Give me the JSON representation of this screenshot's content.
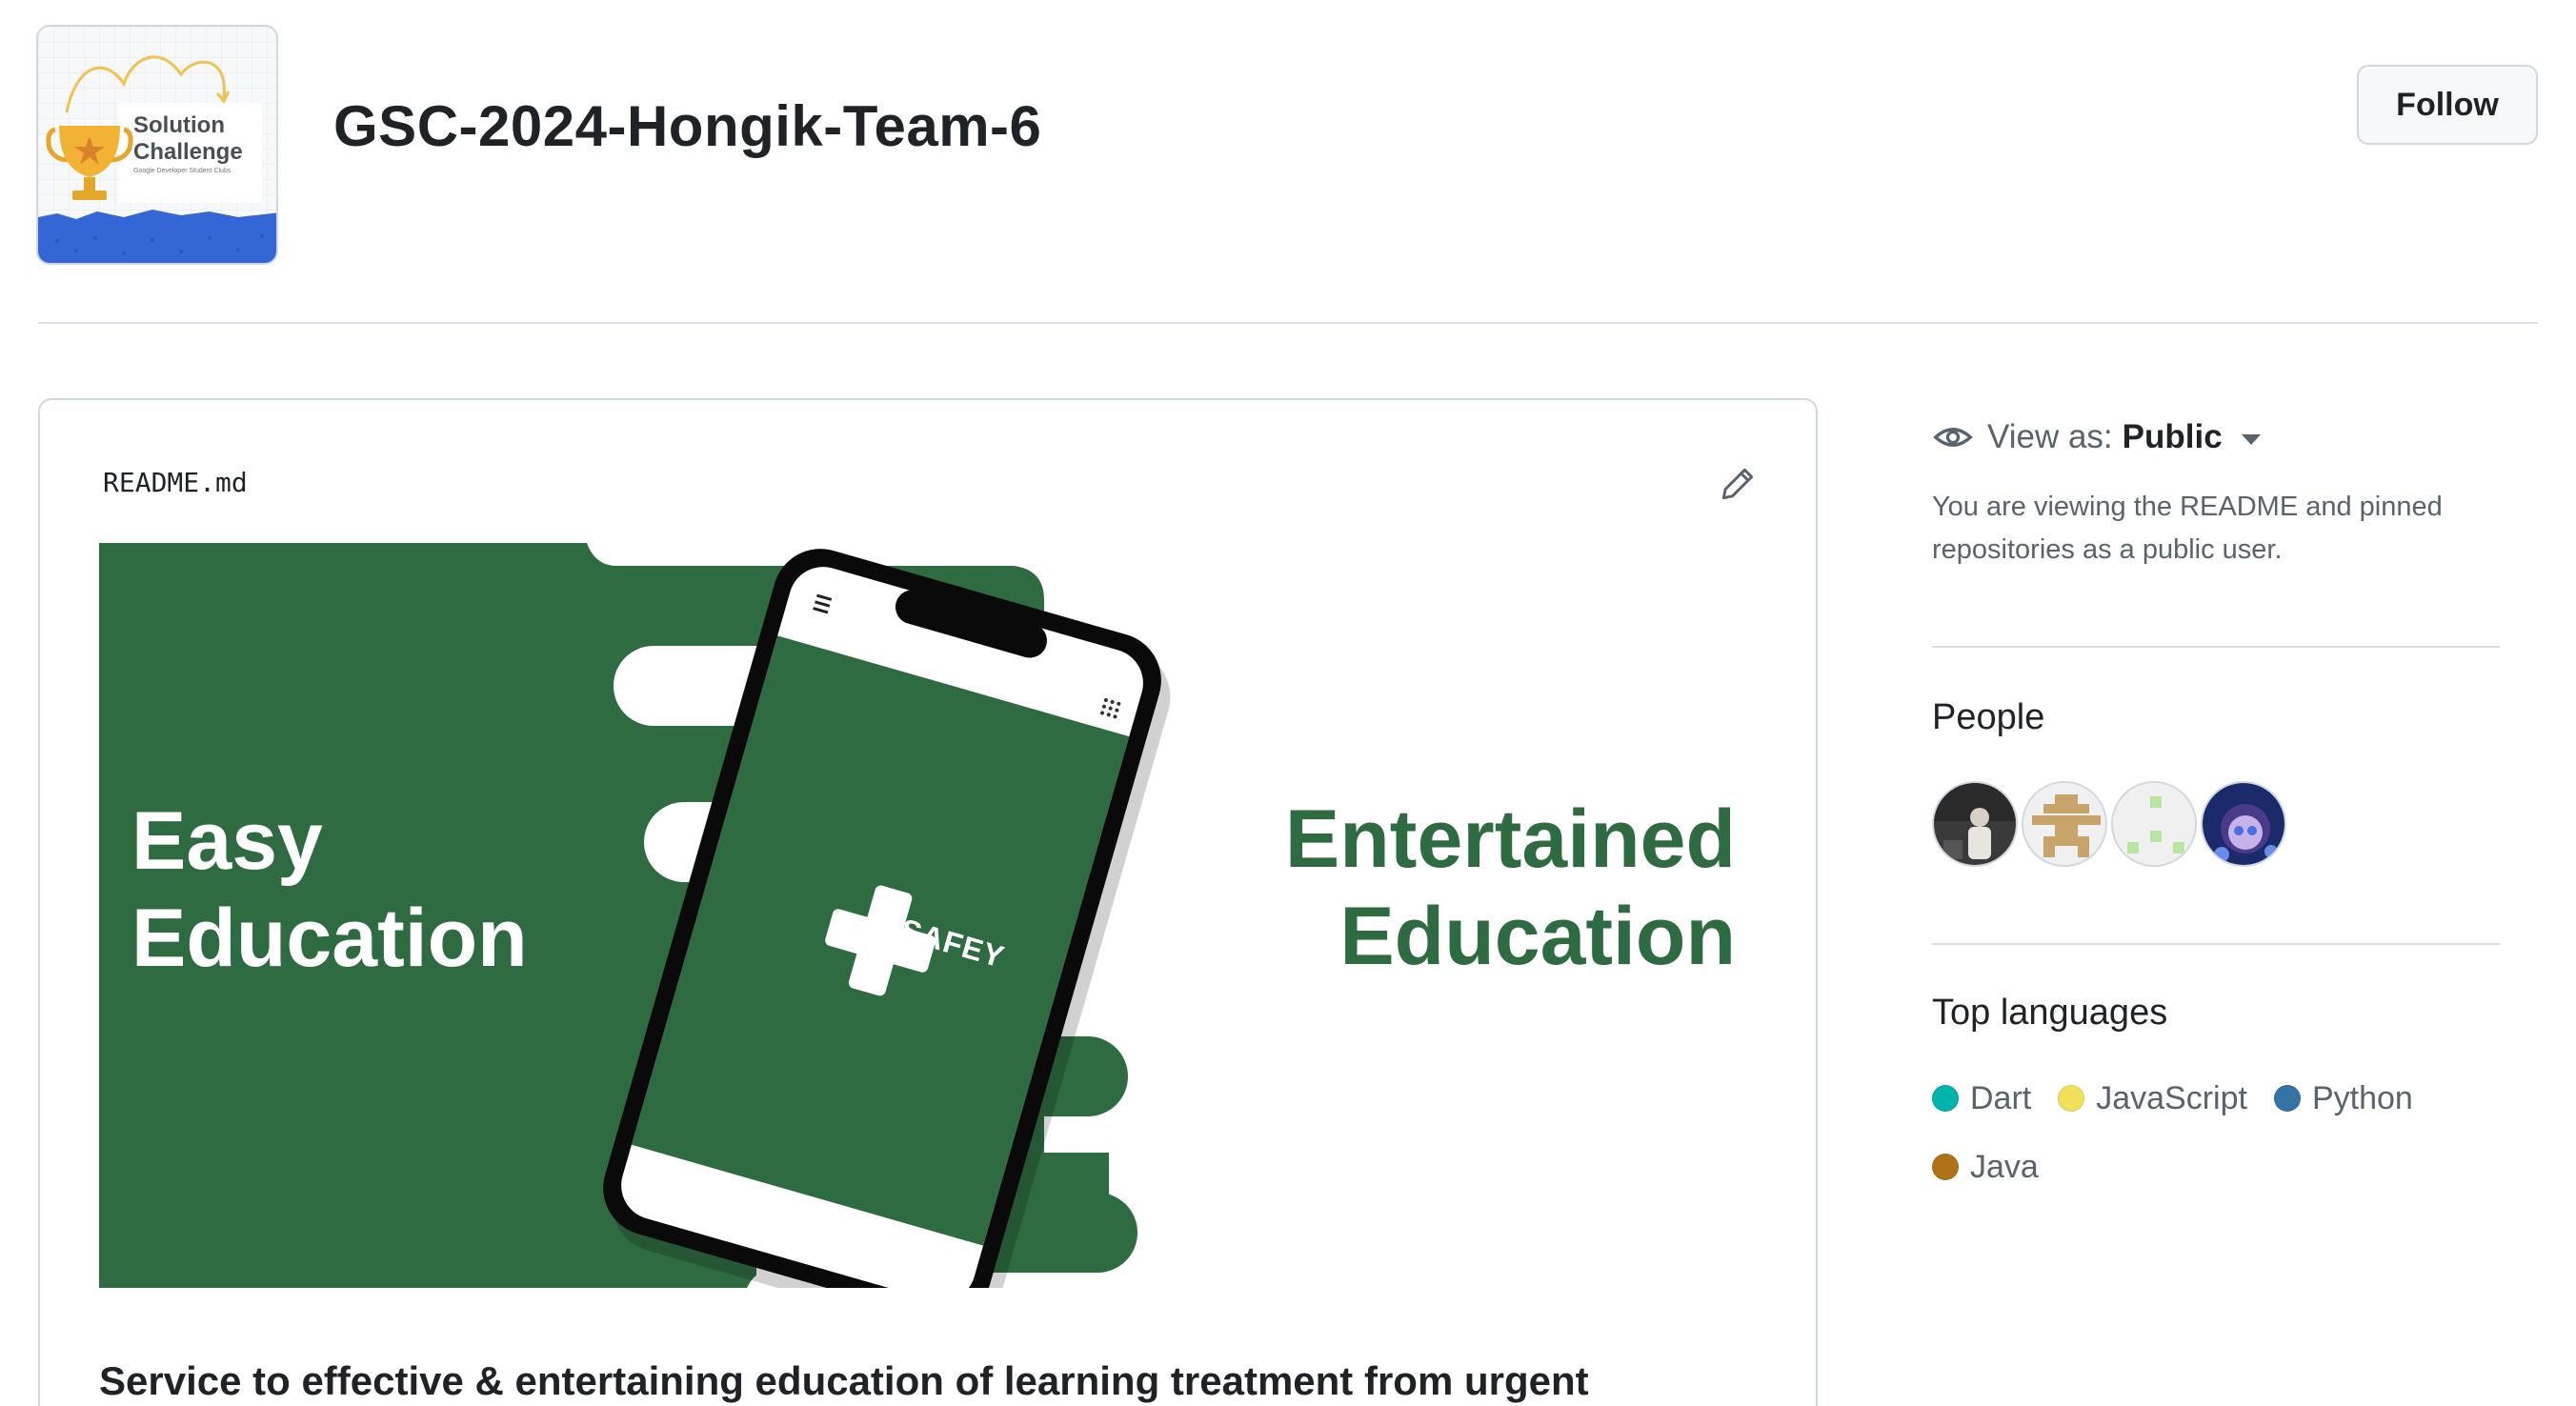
{
  "org": {
    "name": "GSC-2024-Hongik-Team-6",
    "avatar_text_line1": "Solution",
    "avatar_text_line2": "Challenge",
    "avatar_subtext": "Google Developer Student Clubs",
    "follow_label": "Follow"
  },
  "readme": {
    "filename": "README.md",
    "banner_left_line1": "Easy",
    "banner_left_line2": "Education",
    "banner_right_line1": "Entertained",
    "banner_right_line2": "Education",
    "phone_app_name": "SAFEY",
    "description": "Service to effective & entertaining education of learning treatment from urgent"
  },
  "sidebar": {
    "view_as_label": "View as:",
    "view_as_value": "Public",
    "view_as_description": "You are viewing the README and pinned repositories as a public user.",
    "people_heading": "People",
    "languages_heading": "Top languages",
    "languages": [
      {
        "name": "Dart",
        "color": "#00B4AB"
      },
      {
        "name": "JavaScript",
        "color": "#f1e05a"
      },
      {
        "name": "Python",
        "color": "#3572A5"
      },
      {
        "name": "Java",
        "color": "#b07219"
      }
    ]
  },
  "colors": {
    "banner_green": "#2f6b40",
    "accent": "#1f2328"
  }
}
